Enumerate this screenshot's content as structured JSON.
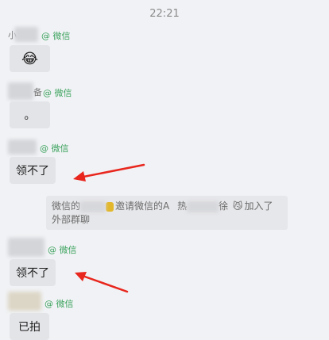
{
  "timestamp": "22:21",
  "wechat_tag": "@ 微信",
  "messages": [
    {
      "sender_fragment": "小",
      "emoji": "😂",
      "text": ""
    },
    {
      "sender_fragment": "备",
      "emoji": "",
      "text": "。"
    },
    {
      "sender_fragment": "",
      "emoji": "",
      "text": "领不了"
    },
    {
      "sender_fragment": "",
      "emoji": "",
      "text": "领不了"
    },
    {
      "sender_fragment": "",
      "emoji": "",
      "text": "已拍"
    }
  ],
  "system_notice": {
    "prefix": "微信的",
    "middle": "邀请微信的A",
    "hot": "热",
    "suffix": "徐",
    "cat_emoji": "😼",
    "joined": "加入了",
    "line2": "外部群聊"
  },
  "colors": {
    "accent_green": "#3ca35e",
    "arrow_red": "#e8261d"
  }
}
